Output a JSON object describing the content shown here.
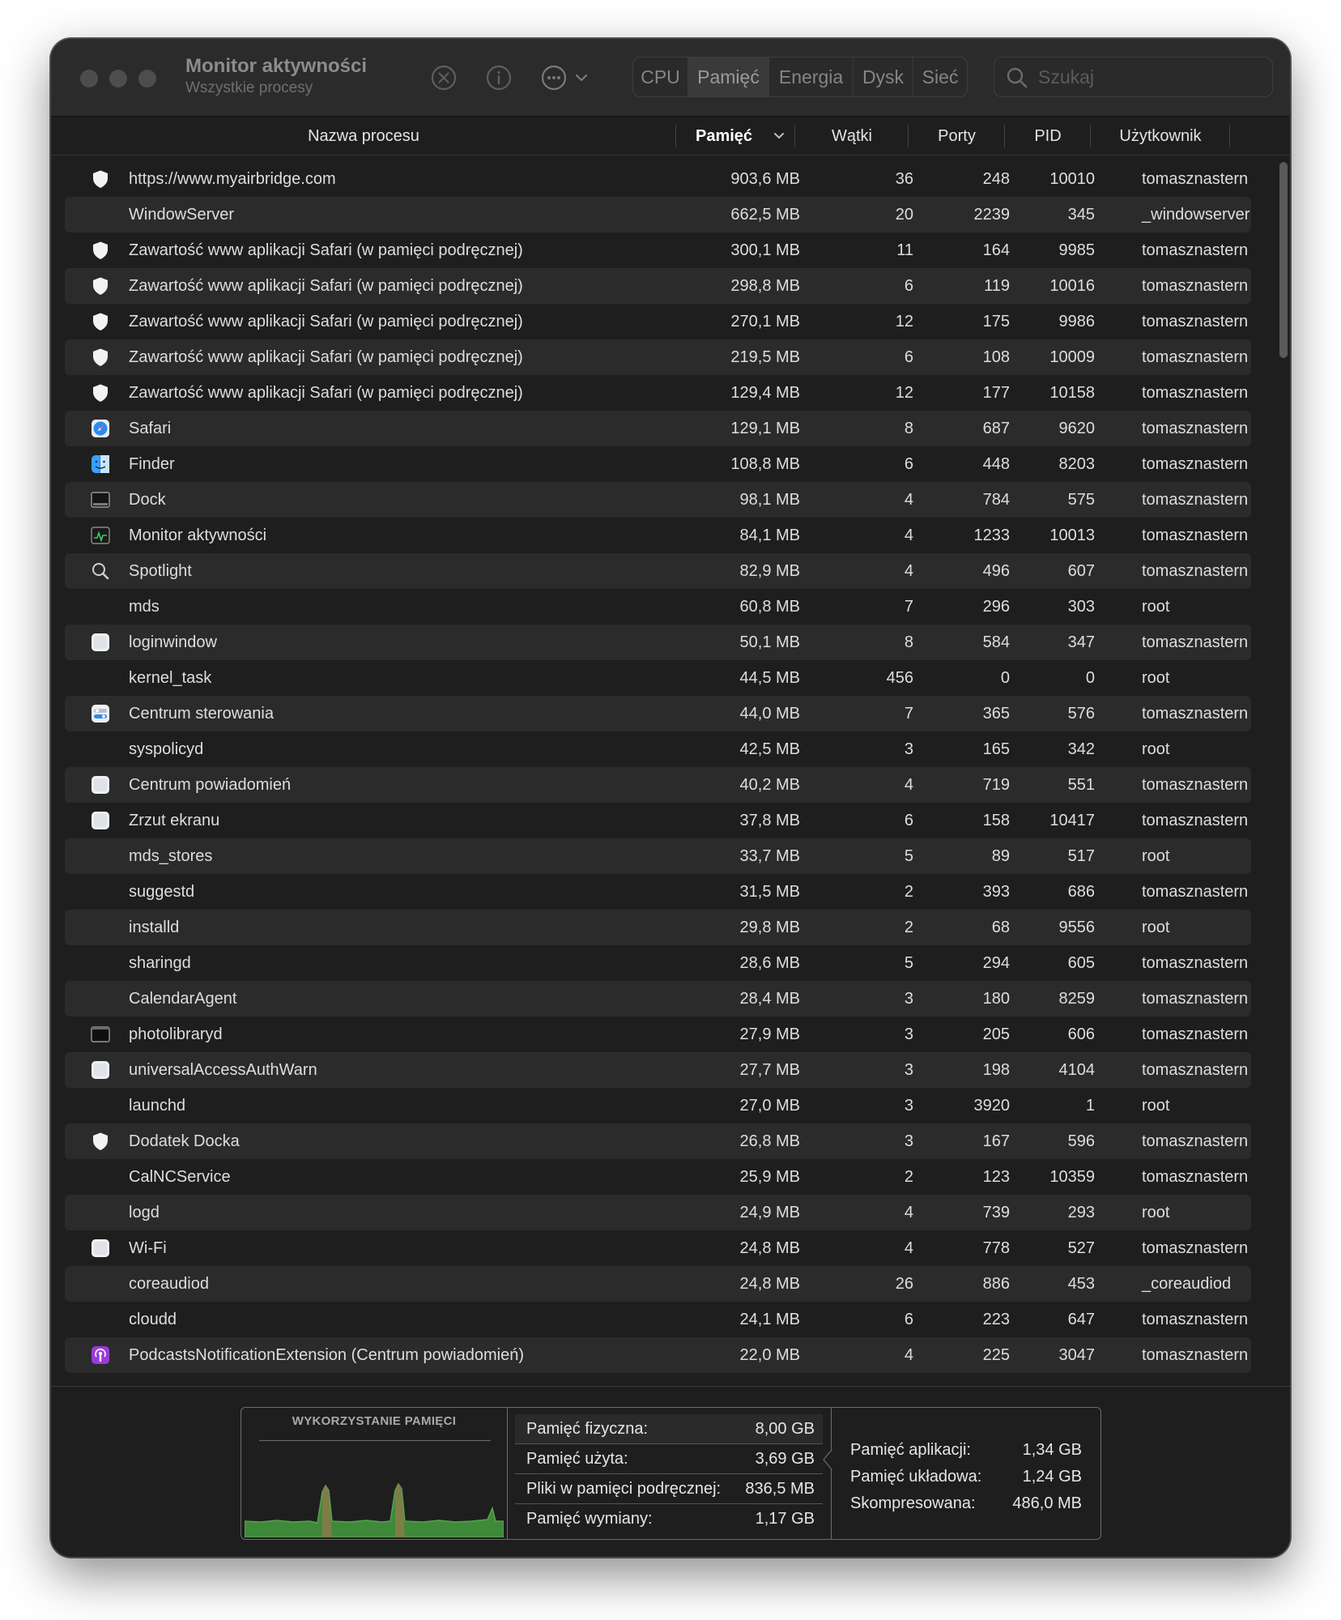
{
  "window": {
    "title": "Monitor aktywności",
    "subtitle": "Wszystkie procesy"
  },
  "toolbar": {
    "icons": [
      "stop-process-icon",
      "info-icon",
      "more-actions-icon",
      "chevron-down-icon"
    ],
    "tabs": [
      {
        "label": "CPU",
        "active": false
      },
      {
        "label": "Pamięć",
        "active": true
      },
      {
        "label": "Energia",
        "active": false
      },
      {
        "label": "Dysk",
        "active": false
      },
      {
        "label": "Sieć",
        "active": false
      }
    ],
    "search": {
      "placeholder": "Szukaj",
      "value": ""
    }
  },
  "columns": {
    "name": "Nazwa procesu",
    "memory": "Pamięć",
    "threads": "Wątki",
    "ports": "Porty",
    "pid": "PID",
    "user": "Użytkownik",
    "sorted_by": "memory"
  },
  "processes": [
    {
      "name": "https://www.myairbridge.com",
      "memory": "903,6 MB",
      "threads": "36",
      "ports": "248",
      "pid": "10010",
      "user": "tomasznastern",
      "icon": "shield-icon"
    },
    {
      "name": "WindowServer",
      "memory": "662,5 MB",
      "threads": "20",
      "ports": "2239",
      "pid": "345",
      "user": "_windowserver",
      "icon": ""
    },
    {
      "name": "Zawartość www aplikacji Safari (w pamięci podręcznej)",
      "memory": "300,1 MB",
      "threads": "11",
      "ports": "164",
      "pid": "9985",
      "user": "tomasznastern",
      "icon": "shield-icon"
    },
    {
      "name": "Zawartość www aplikacji Safari (w pamięci podręcznej)",
      "memory": "298,8 MB",
      "threads": "6",
      "ports": "119",
      "pid": "10016",
      "user": "tomasznastern",
      "icon": "shield-icon"
    },
    {
      "name": "Zawartość www aplikacji Safari (w pamięci podręcznej)",
      "memory": "270,1 MB",
      "threads": "12",
      "ports": "175",
      "pid": "9986",
      "user": "tomasznastern",
      "icon": "shield-icon"
    },
    {
      "name": "Zawartość www aplikacji Safari (w pamięci podręcznej)",
      "memory": "219,5 MB",
      "threads": "6",
      "ports": "108",
      "pid": "10009",
      "user": "tomasznastern",
      "icon": "shield-icon"
    },
    {
      "name": "Zawartość www aplikacji Safari (w pamięci podręcznej)",
      "memory": "129,4 MB",
      "threads": "12",
      "ports": "177",
      "pid": "10158",
      "user": "tomasznastern",
      "icon": "shield-icon"
    },
    {
      "name": "Safari",
      "memory": "129,1 MB",
      "threads": "8",
      "ports": "687",
      "pid": "9620",
      "user": "tomasznastern",
      "icon": "safari-icon"
    },
    {
      "name": "Finder",
      "memory": "108,8 MB",
      "threads": "6",
      "ports": "448",
      "pid": "8203",
      "user": "tomasznastern",
      "icon": "finder-icon"
    },
    {
      "name": "Dock",
      "memory": "98,1 MB",
      "threads": "4",
      "ports": "784",
      "pid": "575",
      "user": "tomasznastern",
      "icon": "dock-icon"
    },
    {
      "name": "Monitor aktywności",
      "memory": "84,1 MB",
      "threads": "4",
      "ports": "1233",
      "pid": "10013",
      "user": "tomasznastern",
      "icon": "activity-monitor-icon"
    },
    {
      "name": "Spotlight",
      "memory": "82,9 MB",
      "threads": "4",
      "ports": "496",
      "pid": "607",
      "user": "tomasznastern",
      "icon": "spotlight-icon"
    },
    {
      "name": "mds",
      "memory": "60,8 MB",
      "threads": "7",
      "ports": "296",
      "pid": "303",
      "user": "root",
      "icon": ""
    },
    {
      "name": "loginwindow",
      "memory": "50,1 MB",
      "threads": "8",
      "ports": "584",
      "pid": "347",
      "user": "tomasznastern",
      "icon": "app-icon"
    },
    {
      "name": "kernel_task",
      "memory": "44,5 MB",
      "threads": "456",
      "ports": "0",
      "pid": "0",
      "user": "root",
      "icon": ""
    },
    {
      "name": "Centrum sterowania",
      "memory": "44,0 MB",
      "threads": "7",
      "ports": "365",
      "pid": "576",
      "user": "tomasznastern",
      "icon": "control-center-icon"
    },
    {
      "name": "syspolicyd",
      "memory": "42,5 MB",
      "threads": "3",
      "ports": "165",
      "pid": "342",
      "user": "root",
      "icon": ""
    },
    {
      "name": "Centrum powiadomień",
      "memory": "40,2 MB",
      "threads": "4",
      "ports": "719",
      "pid": "551",
      "user": "tomasznastern",
      "icon": "app-icon"
    },
    {
      "name": "Zrzut ekranu",
      "memory": "37,8 MB",
      "threads": "6",
      "ports": "158",
      "pid": "10417",
      "user": "tomasznastern",
      "icon": "app-icon"
    },
    {
      "name": "mds_stores",
      "memory": "33,7 MB",
      "threads": "5",
      "ports": "89",
      "pid": "517",
      "user": "root",
      "icon": ""
    },
    {
      "name": "suggestd",
      "memory": "31,5 MB",
      "threads": "2",
      "ports": "393",
      "pid": "686",
      "user": "tomasznastern",
      "icon": ""
    },
    {
      "name": "installd",
      "memory": "29,8 MB",
      "threads": "2",
      "ports": "68",
      "pid": "9556",
      "user": "root",
      "icon": ""
    },
    {
      "name": "sharingd",
      "memory": "28,6 MB",
      "threads": "5",
      "ports": "294",
      "pid": "605",
      "user": "tomasznastern",
      "icon": ""
    },
    {
      "name": "CalendarAgent",
      "memory": "28,4 MB",
      "threads": "3",
      "ports": "180",
      "pid": "8259",
      "user": "tomasznastern",
      "icon": ""
    },
    {
      "name": "photolibraryd",
      "memory": "27,9 MB",
      "threads": "3",
      "ports": "205",
      "pid": "606",
      "user": "tomasznastern",
      "icon": "terminal-icon"
    },
    {
      "name": "universalAccessAuthWarn",
      "memory": "27,7 MB",
      "threads": "3",
      "ports": "198",
      "pid": "4104",
      "user": "tomasznastern",
      "icon": "app-icon"
    },
    {
      "name": "launchd",
      "memory": "27,0 MB",
      "threads": "3",
      "ports": "3920",
      "pid": "1",
      "user": "root",
      "icon": ""
    },
    {
      "name": "Dodatek Docka",
      "memory": "26,8 MB",
      "threads": "3",
      "ports": "167",
      "pid": "596",
      "user": "tomasznastern",
      "icon": "shield-icon"
    },
    {
      "name": "CalNCService",
      "memory": "25,9 MB",
      "threads": "2",
      "ports": "123",
      "pid": "10359",
      "user": "tomasznastern",
      "icon": ""
    },
    {
      "name": "logd",
      "memory": "24,9 MB",
      "threads": "4",
      "ports": "739",
      "pid": "293",
      "user": "root",
      "icon": ""
    },
    {
      "name": "Wi-Fi",
      "memory": "24,8 MB",
      "threads": "4",
      "ports": "778",
      "pid": "527",
      "user": "tomasznastern",
      "icon": "app-icon"
    },
    {
      "name": "coreaudiod",
      "memory": "24,8 MB",
      "threads": "26",
      "ports": "886",
      "pid": "453",
      "user": "_coreaudiod",
      "icon": ""
    },
    {
      "name": "cloudd",
      "memory": "24,1 MB",
      "threads": "6",
      "ports": "223",
      "pid": "647",
      "user": "tomasznastern",
      "icon": ""
    },
    {
      "name": "PodcastsNotificationExtension (Centrum powiadomień)",
      "memory": "22,0 MB",
      "threads": "4",
      "ports": "225",
      "pid": "3047",
      "user": "tomasznastern",
      "icon": "podcasts-icon"
    }
  ],
  "footer": {
    "graph_title": "WYKORZYSTANIE PAMIĘCI",
    "stats": [
      {
        "label": "Pamięć fizyczna:",
        "value": "8,00 GB"
      },
      {
        "label": "Pamięć użyta:",
        "value": "3,69 GB"
      },
      {
        "label": "Pliki w pamięci podręcznej:",
        "value": "836,5 MB"
      },
      {
        "label": "Pamięć wymiany:",
        "value": "1,17 GB"
      }
    ],
    "detail": [
      {
        "label": "Pamięć aplikacji:",
        "value": "1,34 GB"
      },
      {
        "label": "Pamięć układowa:",
        "value": "1,24 GB"
      },
      {
        "label": "Skompresowana:",
        "value": "486,0 MB"
      }
    ]
  },
  "colors": {
    "window_bg": "#1e1e1e",
    "row_alt": "#2b2b2b",
    "graph_green": "#3f8a3a",
    "graph_spike": "#8a7a4a"
  }
}
